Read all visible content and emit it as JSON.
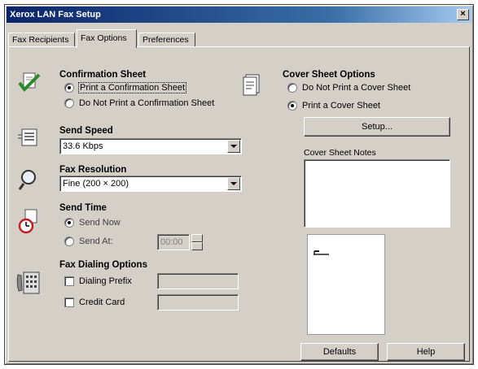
{
  "window": {
    "title": "Xerox LAN Fax Setup",
    "close_label": "×"
  },
  "tabs": [
    {
      "label": "Fax Recipients",
      "active": false
    },
    {
      "label": "Fax Options",
      "active": true
    },
    {
      "label": "Preferences",
      "active": false
    }
  ],
  "confirmation": {
    "title": "Confirmation Sheet",
    "option_print": "Print a Confirmation Sheet",
    "option_no_print": "Do Not Print a Confirmation Sheet",
    "selected": "print"
  },
  "send_speed": {
    "title": "Send Speed",
    "value": "33.6 Kbps"
  },
  "fax_resolution": {
    "title": "Fax Resolution",
    "value": "Fine (200 × 200)"
  },
  "send_time": {
    "title": "Send Time",
    "option_now": "Send Now",
    "option_at": "Send At:",
    "time_value": "00:00",
    "selected": "now"
  },
  "dialing": {
    "title": "Fax Dialing Options",
    "prefix_label": "Dialing Prefix",
    "credit_label": "Credit Card"
  },
  "cover_sheet": {
    "title": "Cover Sheet Options",
    "option_no_print": "Do Not Print a Cover Sheet",
    "option_print": "Print a Cover Sheet",
    "selected": "print",
    "setup_label": "Setup...",
    "notes_label": "Cover Sheet Notes"
  },
  "footer": {
    "defaults_label": "Defaults",
    "help_label": "Help"
  },
  "icons": {
    "confirmation": "confirmation-check-icon",
    "send_speed": "send-speed-icon",
    "resolution": "magnifier-icon",
    "send_time": "clock-icon",
    "dialing": "phone-keypad-icon",
    "cover_sheet": "cover-sheet-icon"
  }
}
